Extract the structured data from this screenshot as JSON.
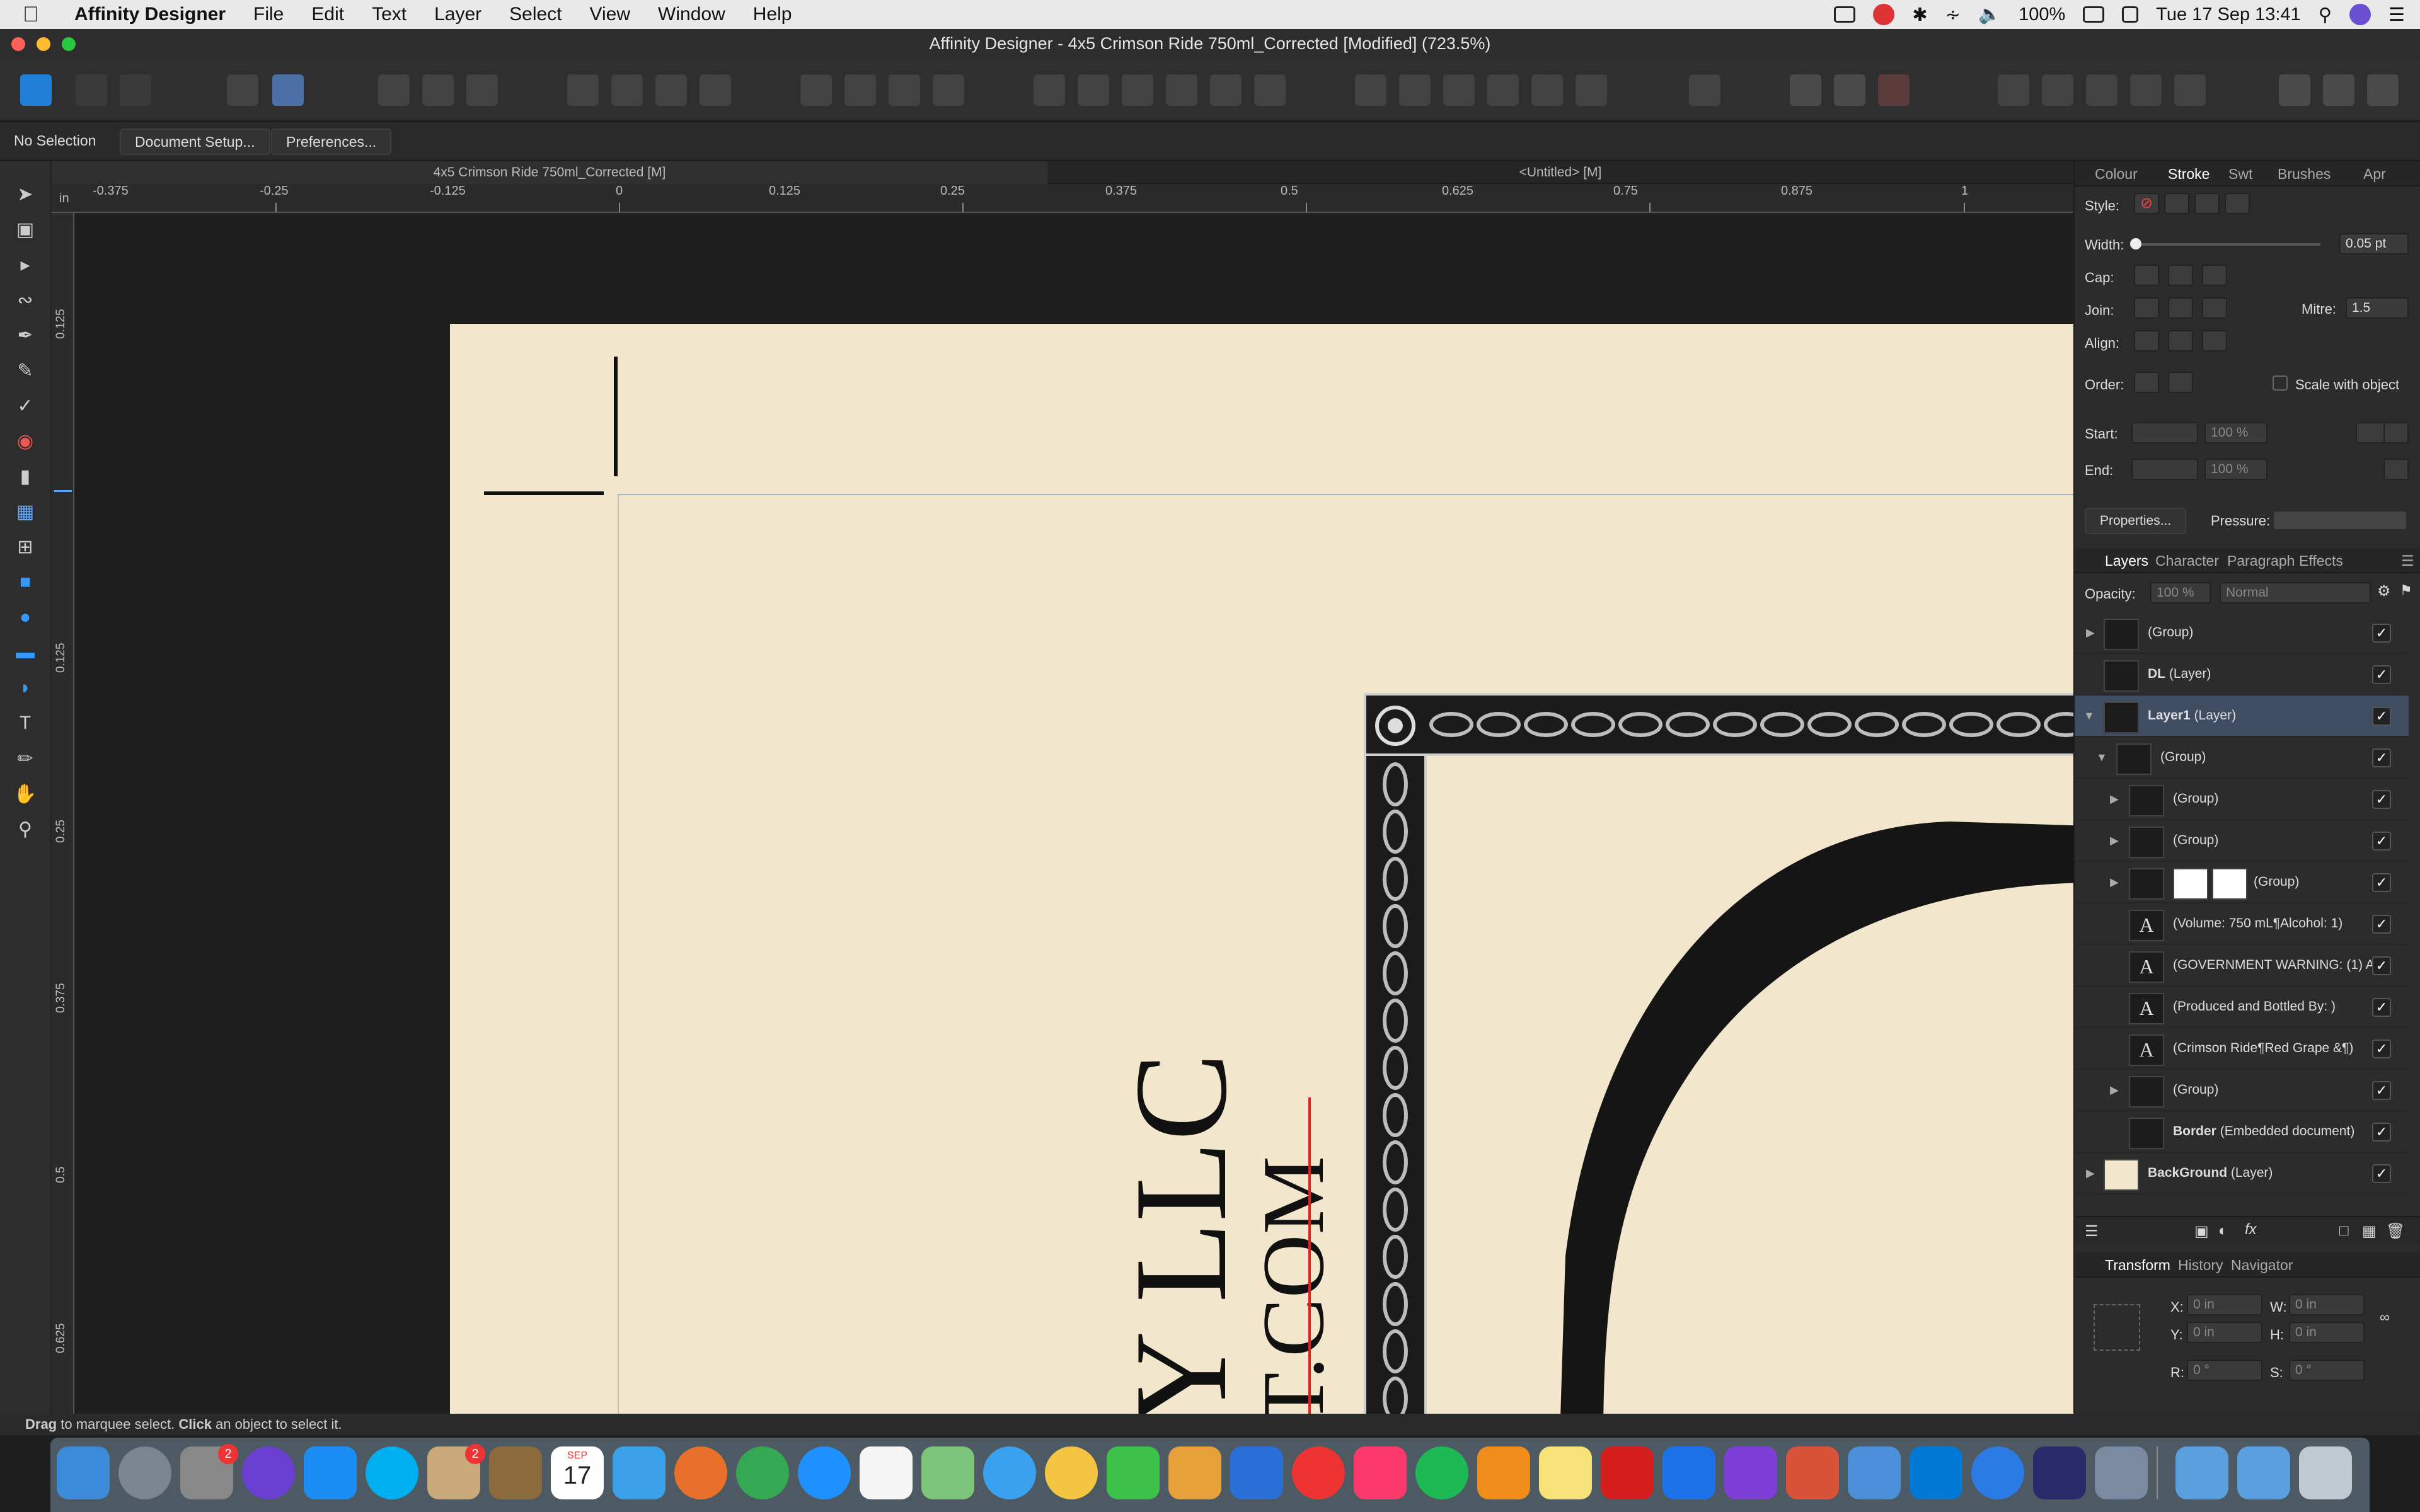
{
  "menubar": {
    "app_name": "Affinity Designer",
    "items": [
      "File",
      "Edit",
      "Text",
      "Layer",
      "Select",
      "View",
      "Window",
      "Help"
    ],
    "battery": "100%",
    "clock": "Tue 17 Sep  13:41"
  },
  "window": {
    "title": "Affinity Designer - 4x5 Crimson Ride 750ml_Corrected [Modified] (723.5%)"
  },
  "context": {
    "selection": "No Selection",
    "document_setup": "Document Setup...",
    "preferences": "Preferences..."
  },
  "doc_tabs": [
    "4x5 Crimson Ride 750ml_Corrected [M]",
    "<Untitled> [M]"
  ],
  "ruler": {
    "unit": "in",
    "h_ticks": [
      "-0.375",
      "-0.25",
      "-0.125",
      "0",
      "0.125",
      "0.25",
      "0.375",
      "0.5",
      "0.625",
      "0.75",
      "0.875",
      "1"
    ],
    "v_ticks": [
      "0.125",
      "0.125",
      "0.25",
      "0.375",
      "0.5",
      "0.625"
    ]
  },
  "canvas": {
    "rotated_text_1": "Y LLC",
    "rotated_text_2": "T.COM"
  },
  "stroke_panel": {
    "tabs": [
      "Colour",
      "Stroke",
      "Swt",
      "Brushes",
      "Apr"
    ],
    "active_tab": "Stroke",
    "style_label": "Style:",
    "width_label": "Width:",
    "width_value": "0.05 pt",
    "cap_label": "Cap:",
    "join_label": "Join:",
    "mitre_label": "Mitre:",
    "mitre_value": "1.5",
    "align_label": "Align:",
    "order_label": "Order:",
    "scale_label": "Scale with object",
    "start_label": "Start:",
    "end_label": "End:",
    "start_pct": "100 %",
    "end_pct": "100 %",
    "properties": "Properties...",
    "pressure_label": "Pressure:"
  },
  "layers_panel": {
    "tabs": [
      "Layers",
      "Character",
      "Paragraph",
      "Effects"
    ],
    "opacity_label": "Opacity:",
    "opacity_value": "100 %",
    "blend_mode": "Normal",
    "rows": [
      {
        "name": "(Group)",
        "bold": ""
      },
      {
        "name": "(Layer)",
        "bold": "DL"
      },
      {
        "name": "(Layer)",
        "bold": "Layer1"
      },
      {
        "name": "(Group)",
        "bold": ""
      },
      {
        "name": "(Group)",
        "bold": ""
      },
      {
        "name": "(Group)",
        "bold": ""
      },
      {
        "name": "(Group)",
        "bold": ""
      },
      {
        "name": "(Volume: 750 mL¶Alcohol: 1)",
        "bold": ""
      },
      {
        "name": "(GOVERNMENT WARNING: (1) A",
        "bold": ""
      },
      {
        "name": "(Produced and Bottled By: )",
        "bold": ""
      },
      {
        "name": "(Crimson Ride¶Red Grape &¶)",
        "bold": ""
      },
      {
        "name": "(Group)",
        "bold": ""
      },
      {
        "name": "(Embedded document)",
        "bold": "Border"
      },
      {
        "name": "(Layer)",
        "bold": "BackGround"
      }
    ]
  },
  "transform_panel": {
    "tabs": [
      "Transform",
      "History",
      "Navigator"
    ],
    "x_label": "X:",
    "x_value": "0 in",
    "y_label": "Y:",
    "y_value": "0 in",
    "w_label": "W:",
    "w_value": "0 in",
    "h_label": "H:",
    "h_value": "0 in",
    "r_label": "R:",
    "r_value": "0 °",
    "s_label": "S:",
    "s_value": "0 °"
  },
  "status": {
    "drag": "Drag",
    "drag_text": " to marquee select. ",
    "click": "Click",
    "click_text": " an object to select it."
  },
  "dock": {
    "badges": [
      "2",
      "2"
    ],
    "calendar_month": "SEP",
    "calendar_day": "17"
  },
  "colors": {
    "artboard": "#f2e7cc",
    "selection_row": "#3f4d63",
    "canvas_bg": "#1f1f1f",
    "accent_red": "#d22"
  }
}
